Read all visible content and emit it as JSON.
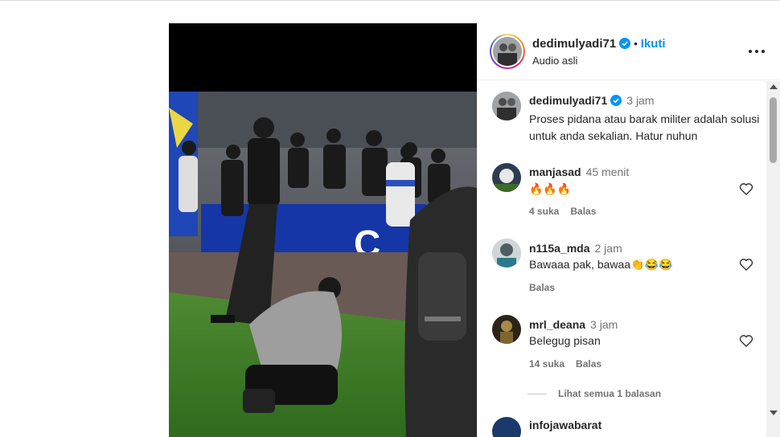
{
  "post": {
    "author": "dedimulyadi71",
    "follow_label": "Ikuti",
    "separator": "•",
    "audio": "Audio asli",
    "caption_time": "3 jam",
    "caption": "Proses pidana atau barak militer adalah solusi untuk anda sekalian. Hatur nuhun"
  },
  "comments": [
    {
      "user": "manjasad",
      "time": "45 menit",
      "text": "🔥🔥🔥",
      "likes": "4 suka",
      "reply": "Balas"
    },
    {
      "user": "n115a_mda",
      "time": "2 jam",
      "text": "Bawaaa pak, bawaa👏😂😂",
      "likes": "",
      "reply": "Balas"
    },
    {
      "user": "mrl_deana",
      "time": "3 jam",
      "text": "Belegug pisan",
      "likes": "14 suka",
      "reply": "Balas"
    }
  ],
  "view_replies": "Lihat semua 1 balasan",
  "partial_next_user": "infojawabarat",
  "colors": {
    "accent": "#0095f6",
    "verified": "#0095f6",
    "muted": "#737373"
  }
}
